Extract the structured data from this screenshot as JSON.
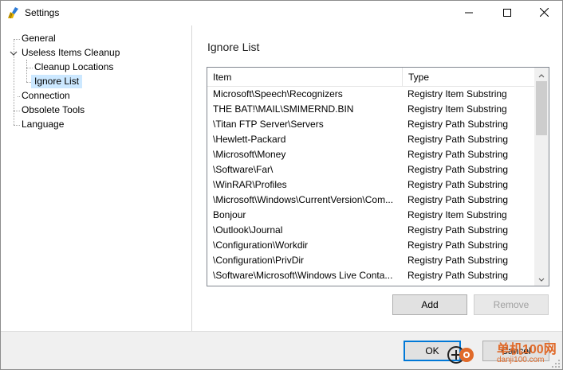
{
  "window": {
    "title": "Settings",
    "icon": "broom-app-icon",
    "controls": [
      "minimize-icon",
      "maximize-icon",
      "close-icon"
    ]
  },
  "tree": {
    "items": [
      {
        "label": "General"
      },
      {
        "label": "Useless Items Cleanup",
        "expanded": true
      },
      {
        "label": "Cleanup Locations"
      },
      {
        "label": "Ignore List",
        "selected": true
      },
      {
        "label": "Connection"
      },
      {
        "label": "Obsolete Tools"
      },
      {
        "label": "Language"
      }
    ]
  },
  "panel": {
    "title": "Ignore List",
    "columns": {
      "item": "Item",
      "type": "Type"
    },
    "rows": [
      {
        "item": "Microsoft\\Speech\\Recognizers",
        "type": "Registry Item Substring"
      },
      {
        "item": "THE BAT!\\MAIL\\SMIMERND.BIN",
        "type": "Registry Item Substring"
      },
      {
        "item": "\\Titan FTP Server\\Servers",
        "type": "Registry Path Substring"
      },
      {
        "item": "\\Hewlett-Packard",
        "type": "Registry Path Substring"
      },
      {
        "item": "\\Microsoft\\Money",
        "type": "Registry Path Substring"
      },
      {
        "item": "\\Software\\Far\\",
        "type": "Registry Path Substring"
      },
      {
        "item": "\\WinRAR\\Profiles",
        "type": "Registry Path Substring"
      },
      {
        "item": "\\Microsoft\\Windows\\CurrentVersion\\Com...",
        "type": "Registry Path Substring"
      },
      {
        "item": "Bonjour",
        "type": "Registry Item Substring"
      },
      {
        "item": "\\Outlook\\Journal",
        "type": "Registry Path Substring"
      },
      {
        "item": "\\Configuration\\Workdir",
        "type": "Registry Path Substring"
      },
      {
        "item": "\\Configuration\\PrivDir",
        "type": "Registry Path Substring"
      },
      {
        "item": "\\Software\\Microsoft\\Windows Live Conta...",
        "type": "Registry Path Substring"
      }
    ],
    "add_label": "Add",
    "remove_label": "Remove"
  },
  "footer": {
    "ok_label": "OK",
    "cancel_label": "Cancel"
  },
  "watermark": {
    "line1": "单机100网",
    "line2": "danji100.com"
  },
  "colors": {
    "accent": "#0078d7",
    "selection": "#cce8ff",
    "footer_bg": "#f0f0f0",
    "watermark": "#e06a2a"
  }
}
